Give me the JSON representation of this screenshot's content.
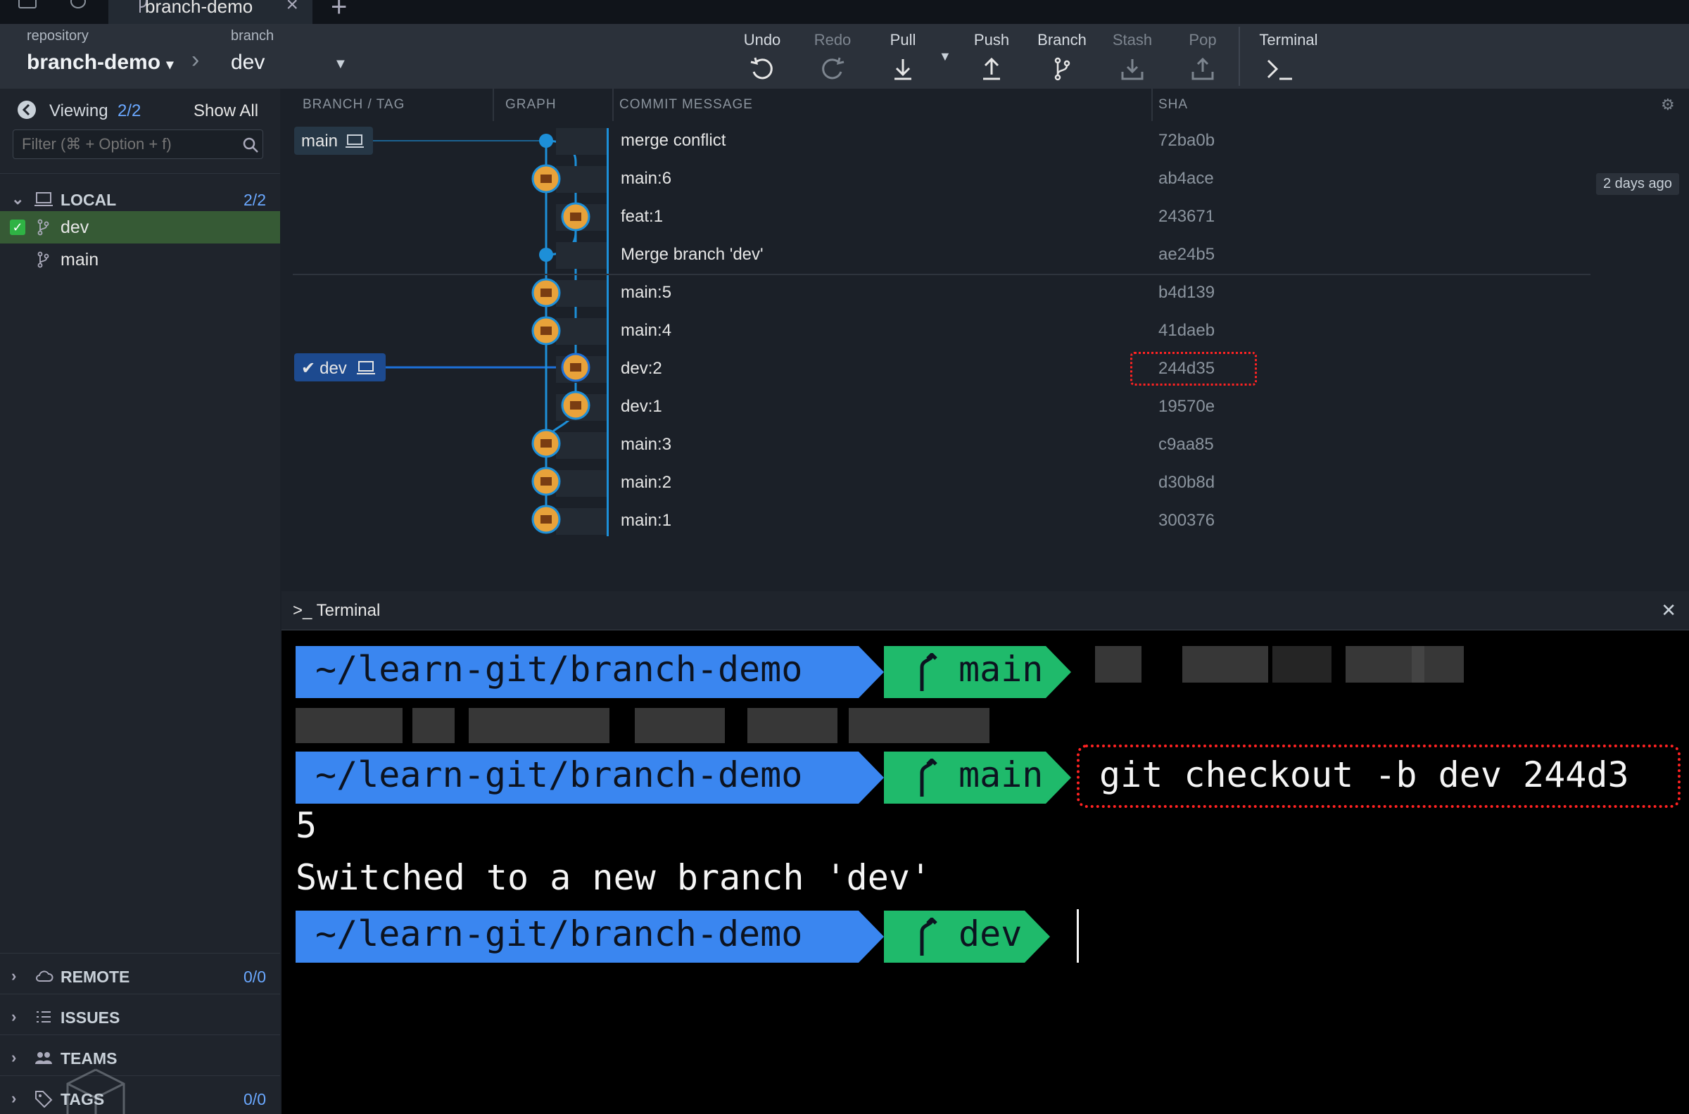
{
  "tab": {
    "title": "branch-demo"
  },
  "toolbar": {
    "repo_label": "repository",
    "repo_name": "branch-demo",
    "branch_label": "branch",
    "branch_name": "dev",
    "buttons": {
      "undo": "Undo",
      "redo": "Redo",
      "pull": "Pull",
      "push": "Push",
      "branch": "Branch",
      "stash": "Stash",
      "pop": "Pop",
      "terminal": "Terminal"
    }
  },
  "sidebar": {
    "viewing_label": "Viewing",
    "viewing_count": "2/2",
    "show_all": "Show All",
    "filter_placeholder": "Filter (⌘ + Option + f)",
    "local": {
      "label": "LOCAL",
      "count": "2/2"
    },
    "branches": [
      {
        "name": "dev",
        "checked": true
      },
      {
        "name": "main",
        "checked": false
      }
    ],
    "remote": {
      "label": "REMOTE",
      "count": "0/0"
    },
    "issues": {
      "label": "ISSUES"
    },
    "teams": {
      "label": "TEAMS"
    },
    "tags": {
      "label": "TAGS",
      "count": "0/0"
    }
  },
  "columns": {
    "branch_tag": "BRANCH / TAG",
    "graph": "GRAPH",
    "message": "COMMIT MESSAGE",
    "sha": "SHA"
  },
  "branch_labels": {
    "main": "main",
    "dev": "dev"
  },
  "commits": [
    {
      "message": "merge conflict",
      "sha": "72ba0b"
    },
    {
      "message": "main:6",
      "sha": "ab4ace"
    },
    {
      "message": "feat:1",
      "sha": "243671"
    },
    {
      "message": "Merge branch 'dev'",
      "sha": "ae24b5"
    },
    {
      "message": "main:5",
      "sha": "b4d139"
    },
    {
      "message": "main:4",
      "sha": "41daeb"
    },
    {
      "message": "dev:2",
      "sha": "244d35"
    },
    {
      "message": "dev:1",
      "sha": "19570e"
    },
    {
      "message": "main:3",
      "sha": "c9aa85"
    },
    {
      "message": "main:2",
      "sha": "d30b8d"
    },
    {
      "message": "main:1",
      "sha": "300376"
    }
  ],
  "time_marker": "2 days ago",
  "terminal": {
    "title": "Terminal",
    "path": "~/learn-git/branch-demo",
    "branch1": "main",
    "branch2": "main",
    "branch3": "dev",
    "command": "git checkout -b dev 244d3",
    "command_wrap": "5",
    "output": "Switched to a new branch 'dev'"
  },
  "colors": {
    "accent": "#3a86f0",
    "green": "#1fba6b",
    "highlight": "#ff2222",
    "graph_line": "#1d8fd8"
  }
}
